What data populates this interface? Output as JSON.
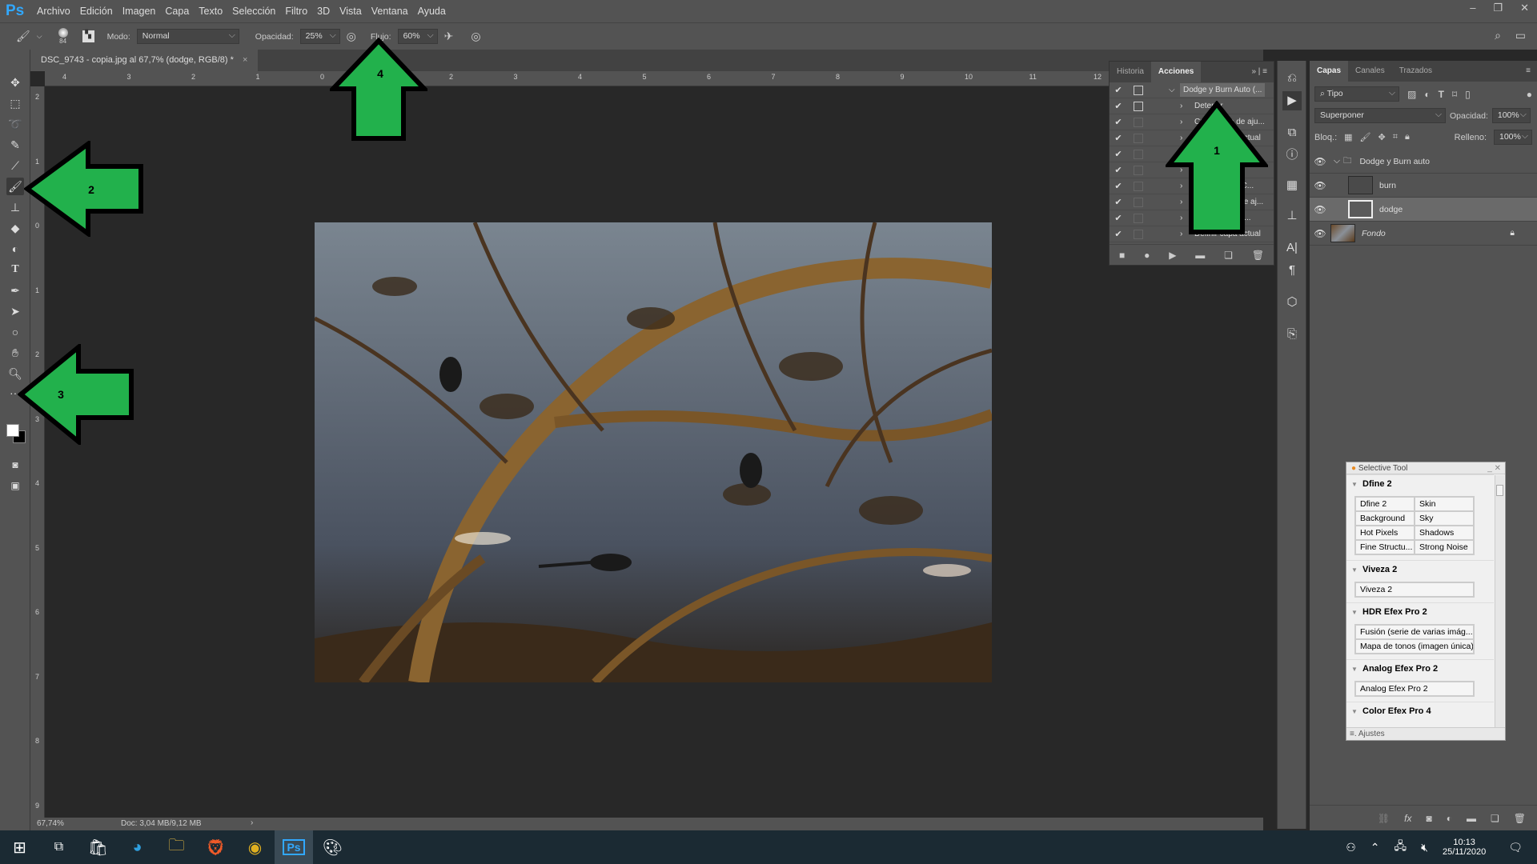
{
  "app": {
    "logo": "Ps",
    "menu": [
      "Archivo",
      "Edición",
      "Imagen",
      "Capa",
      "Texto",
      "Selección",
      "Filtro",
      "3D",
      "Vista",
      "Ventana",
      "Ayuda"
    ]
  },
  "options": {
    "brush_size": "84",
    "mode_label": "Modo:",
    "mode_value": "Normal",
    "opacity_label": "Opacidad:",
    "opacity_value": "25%",
    "flow_label": "Flujo:",
    "flow_value": "60%"
  },
  "document": {
    "tab_title": "DSC_9743 - copia.jpg al 67,7% (dodge, RGB/8) *",
    "close": "×",
    "zoom": "67,74%",
    "doc_info": "Doc: 3,04 MB/9,12 MB"
  },
  "rulers": {
    "horizontal": [
      "4",
      "3",
      "2",
      "1",
      "0",
      "1",
      "2",
      "3",
      "4",
      "5",
      "6",
      "7",
      "8",
      "9",
      "10",
      "11",
      "12"
    ],
    "vertical": [
      "2",
      "1",
      "0",
      "1",
      "2",
      "3",
      "4",
      "5",
      "6",
      "7",
      "8",
      "9"
    ]
  },
  "actions_panel": {
    "tabs": [
      "Historia",
      "Acciones"
    ],
    "active_tab": "Acciones",
    "set_name": "Dodge y Burn Auto (...",
    "items": [
      "Detener",
      "Crear capa de aju...",
      "Definir capa actual",
      "",
      "Crear...",
      "Seleccionar \"C...",
      "Definir capa de aj...",
      "Seleccionar R...",
      "Definir capa actual"
    ]
  },
  "layers_panel": {
    "tabs": [
      "Capas",
      "Canales",
      "Trazados"
    ],
    "active_tab": "Capas",
    "filter": "Tipo",
    "blend_mode": "Superponer",
    "opacity_label": "Opacidad:",
    "opacity": "100%",
    "lock_label": "Bloq.:",
    "fill_label": "Relleno:",
    "fill": "100%",
    "layers": [
      {
        "name": "Dodge y Burn auto",
        "type": "group"
      },
      {
        "name": "burn",
        "type": "layer"
      },
      {
        "name": "dodge",
        "type": "layer",
        "selected": true
      },
      {
        "name": "Fondo",
        "type": "background",
        "locked": true
      }
    ]
  },
  "selective_tool": {
    "title": "Selective Tool",
    "sections": [
      {
        "name": "Dfine 2",
        "buttons": [
          "Dfine 2",
          "Skin",
          "Background",
          "Sky",
          "Hot Pixels",
          "Shadows",
          "Fine Structu...",
          "Strong Noise"
        ]
      },
      {
        "name": "Viveza 2",
        "buttons": [
          "Viveza 2"
        ]
      },
      {
        "name": "HDR Efex Pro 2",
        "buttons": [
          "Fusión (serie de varias imág...",
          "Mapa de tonos (imagen única)"
        ]
      },
      {
        "name": "Analog Efex Pro 2",
        "buttons": [
          "Analog Efex Pro 2"
        ]
      },
      {
        "name": "Color Efex Pro 4",
        "buttons": []
      }
    ],
    "footer_tab": "Ajustes"
  },
  "annotations": {
    "arrow_1": "1",
    "arrow_2": "2",
    "arrow_3": "3",
    "arrow_4": "4",
    "color": "#22b14c"
  },
  "taskbar": {
    "time": "10:13",
    "date": "25/11/2020"
  }
}
